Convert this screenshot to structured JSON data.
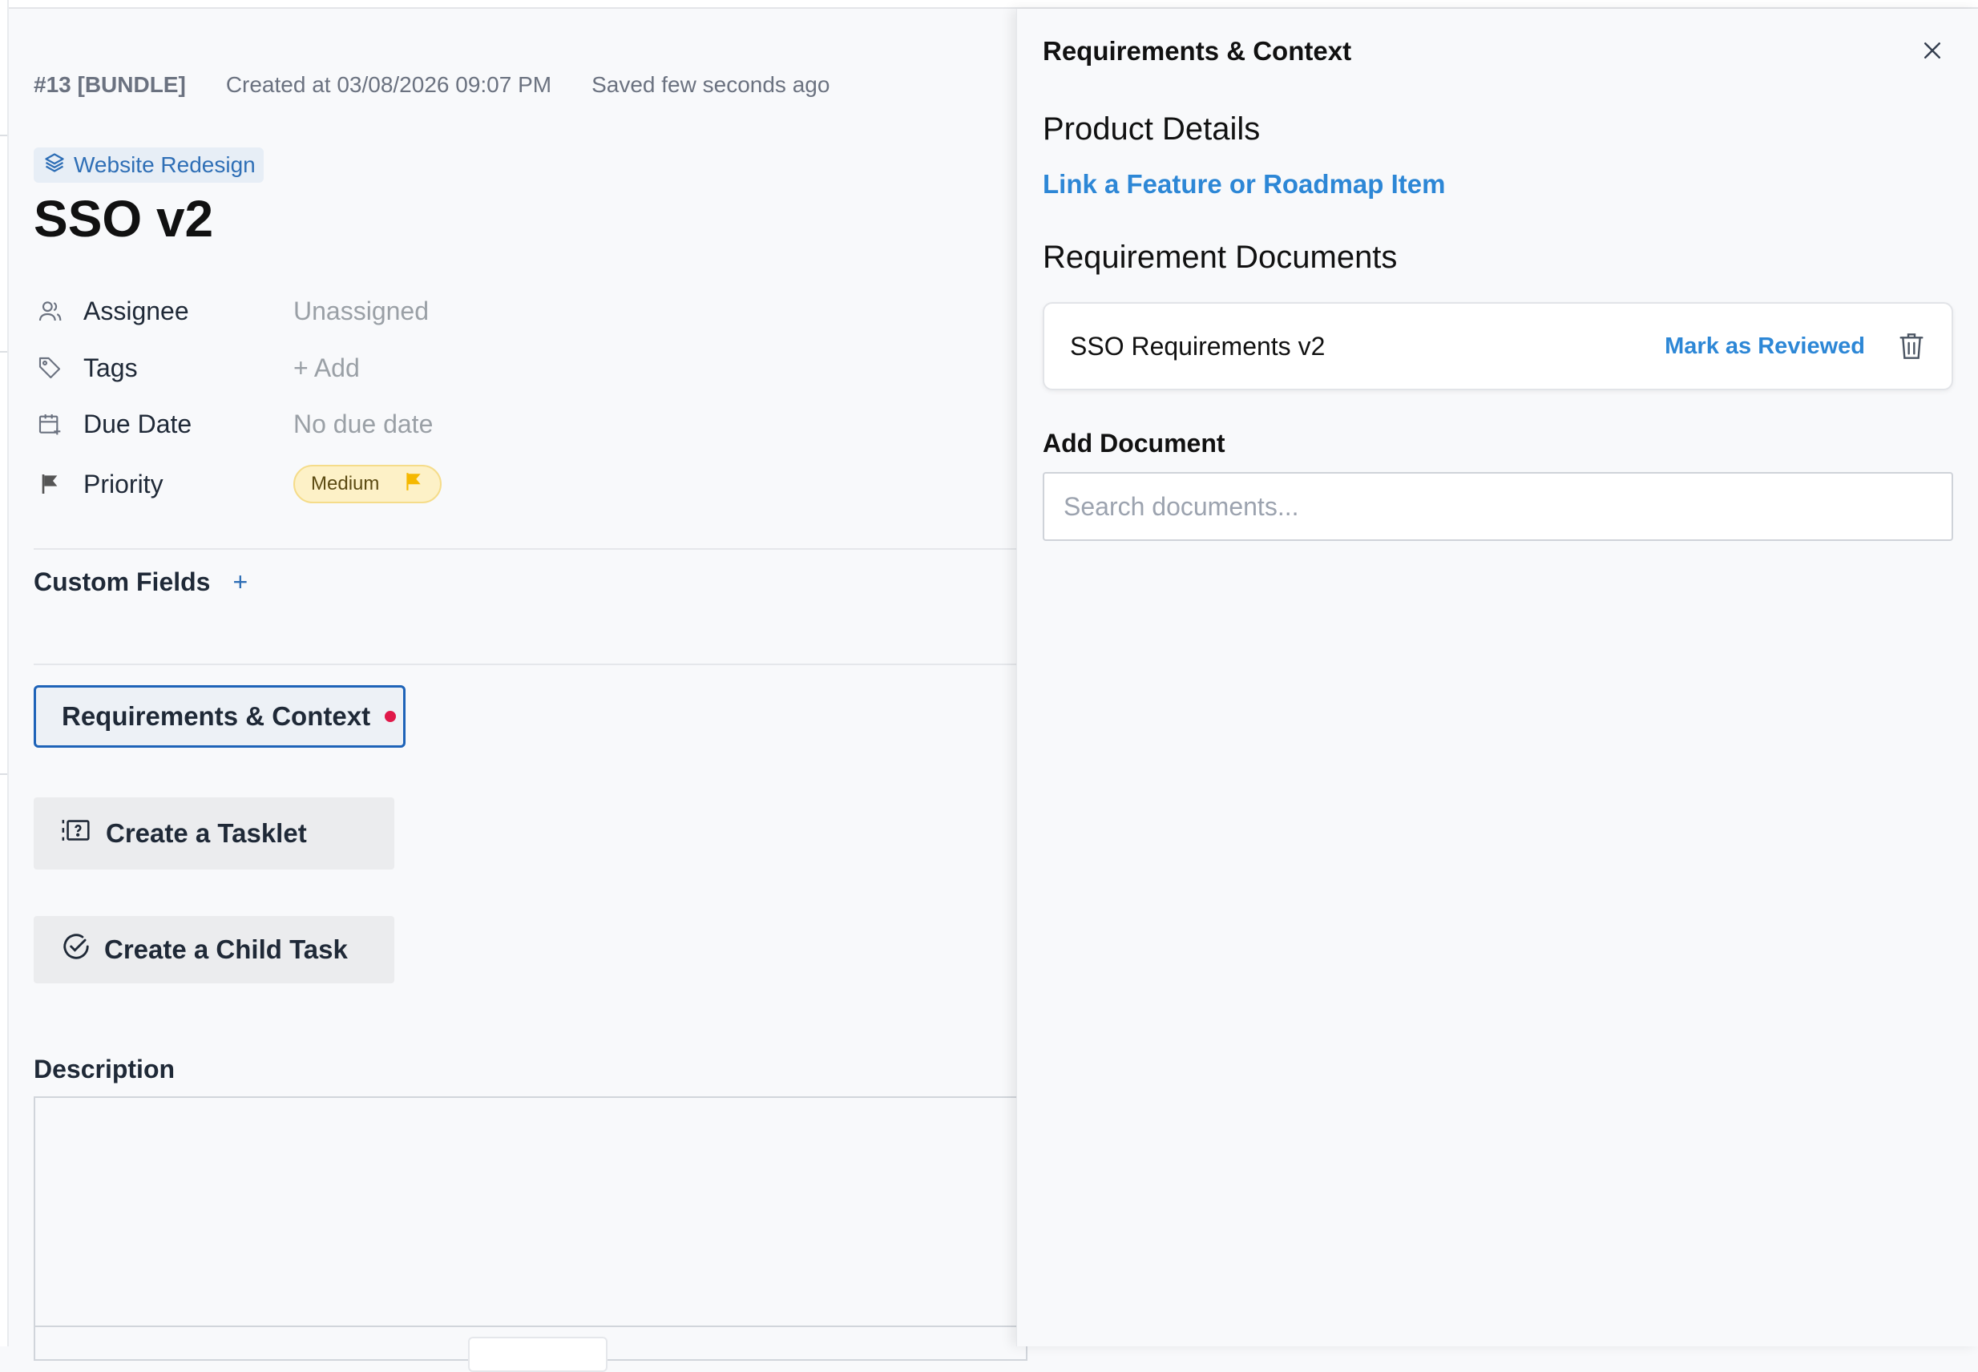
{
  "task": {
    "id": "#13 [BUNDLE]",
    "created": "Created at 03/08/2026 09:07 PM",
    "saved": "Saved few seconds ago",
    "project": "Website Redesign",
    "title": "SSO v2"
  },
  "fields": {
    "assignee": {
      "label": "Assignee",
      "value": "Unassigned",
      "icon": "user-icon"
    },
    "tags": {
      "label": "Tags",
      "value": "+ Add",
      "icon": "tag-icon"
    },
    "due_date": {
      "label": "Due Date",
      "value": "No due date",
      "icon": "calendar-icon"
    },
    "priority": {
      "label": "Priority",
      "value": "Medium",
      "icon": "flag-icon",
      "color": "#f5b800"
    }
  },
  "custom_fields": {
    "label": "Custom Fields",
    "add": "+"
  },
  "buttons": {
    "requirements": "Requirements & Context",
    "tasklet": "Create a Tasklet",
    "child_task": "Create a Child Task"
  },
  "description": {
    "label": "Description"
  },
  "panel": {
    "title": "Requirements & Context",
    "product_details": "Product Details",
    "link_feature": "Link a Feature or Roadmap Item",
    "requirement_docs": "Requirement Documents",
    "documents": [
      {
        "name": "SSO Requirements v2",
        "action": "Mark as Reviewed"
      }
    ],
    "add_document": "Add Document",
    "search_placeholder": "Search documents..."
  },
  "colors": {
    "accent": "#2d87d6",
    "focus": "#1e63b8",
    "alert_dot": "#e0194a"
  }
}
